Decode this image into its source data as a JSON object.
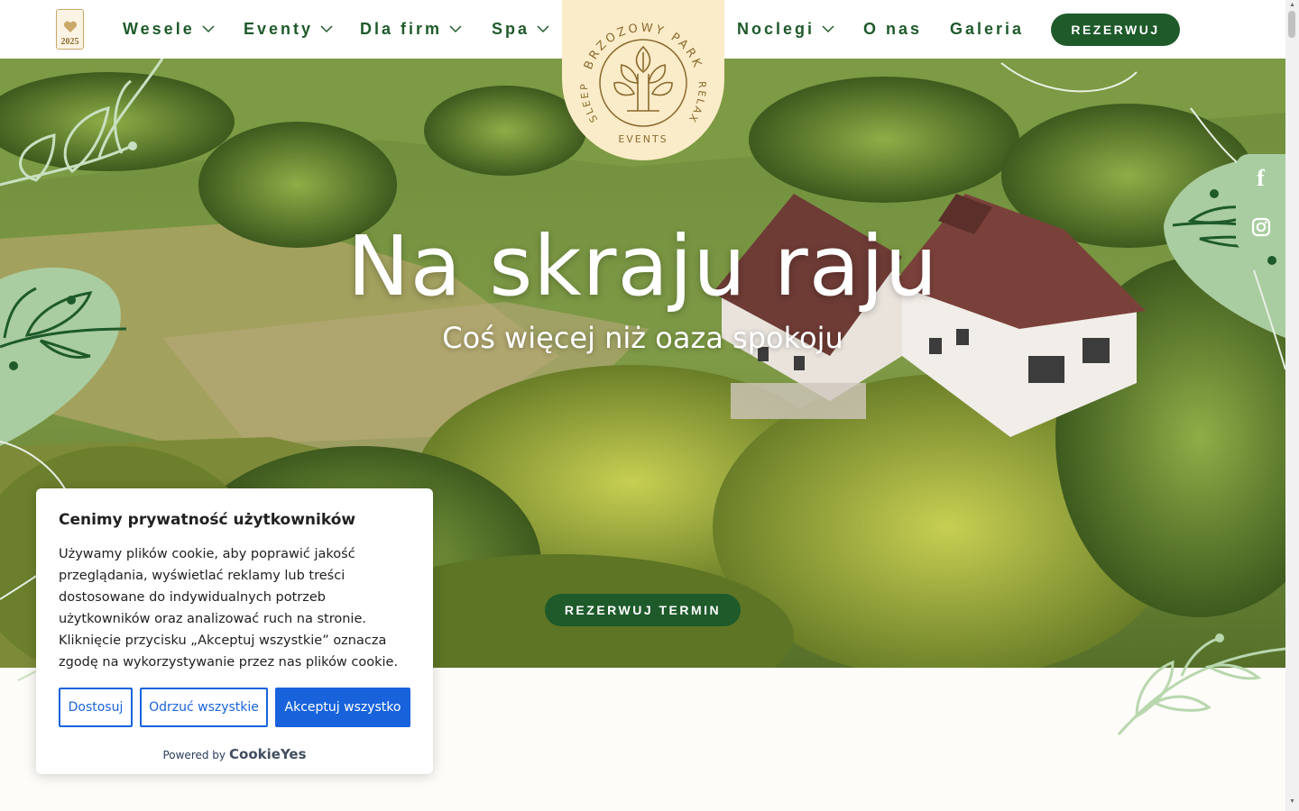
{
  "award": {
    "year": "2025"
  },
  "nav": {
    "items": [
      {
        "label": "Wesele",
        "dropdown": true
      },
      {
        "label": "Eventy",
        "dropdown": true
      },
      {
        "label": "Dla firm",
        "dropdown": true
      },
      {
        "label": "Spa",
        "dropdown": true
      },
      {
        "label": "Noclegi",
        "dropdown": true
      },
      {
        "label": "O nas",
        "dropdown": false
      },
      {
        "label": "Galeria",
        "dropdown": false
      }
    ],
    "book_label": "REZERWUJ"
  },
  "logo": {
    "top_text": "BRZOZOWY PARK",
    "left_text": "SLEEP",
    "right_text": "RELAX",
    "bottom_text": "EVENTS"
  },
  "hero": {
    "title": "Na skraju raju",
    "subtitle": "Coś więcej niż oaza spokoju",
    "cta_label": "REZERWUJ TERMIN"
  },
  "social": {
    "facebook": "f",
    "instagram_icon": "instagram-icon"
  },
  "cookie": {
    "title": "Cenimy prywatność użytkowników",
    "text": "Używamy plików cookie, aby poprawić jakość przeglądania, wyświetlać reklamy lub treści dostosowane do indywidualnych potrzeb użytkowników oraz analizować ruch na stronie. Kliknięcie przycisku „Akceptuj wszystkie” oznacza zgodę na wykorzystywanie przez nas plików cookie.",
    "customize_label": "Dostosuj",
    "reject_label": "Odrzuć wszystkie",
    "accept_label": "Akceptuj wszystko",
    "powered_by": "Powered by",
    "brand": "CookieYes"
  },
  "colors": {
    "brand_green": "#1e5a2a",
    "leaf_green": "#a9cda0",
    "cream": "#fbecc9",
    "cookie_blue": "#1863dc"
  }
}
